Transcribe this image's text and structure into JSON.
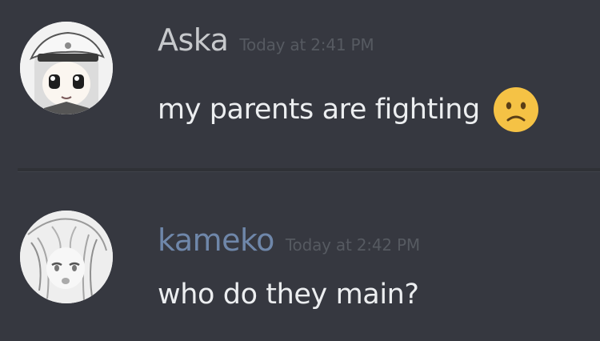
{
  "messages": [
    {
      "username": "Aska",
      "timestamp": "Today at 2:41 PM",
      "text": "my parents are fighting",
      "emoji": "frowning-face-emoji",
      "avatar": "anime-girl-with-hat-avatar",
      "name_color": "#c7c9cc"
    },
    {
      "username": "kameko",
      "timestamp": "Today at 2:42 PM",
      "text": "who do they main?",
      "avatar": "sketched-anime-girl-avatar",
      "name_color": "#6f87aa"
    }
  ],
  "colors": {
    "background": "#363840",
    "divider": "#2f3136",
    "text": "#eceef0",
    "timestamp": "#565a61",
    "emoji": "#f5c245"
  }
}
